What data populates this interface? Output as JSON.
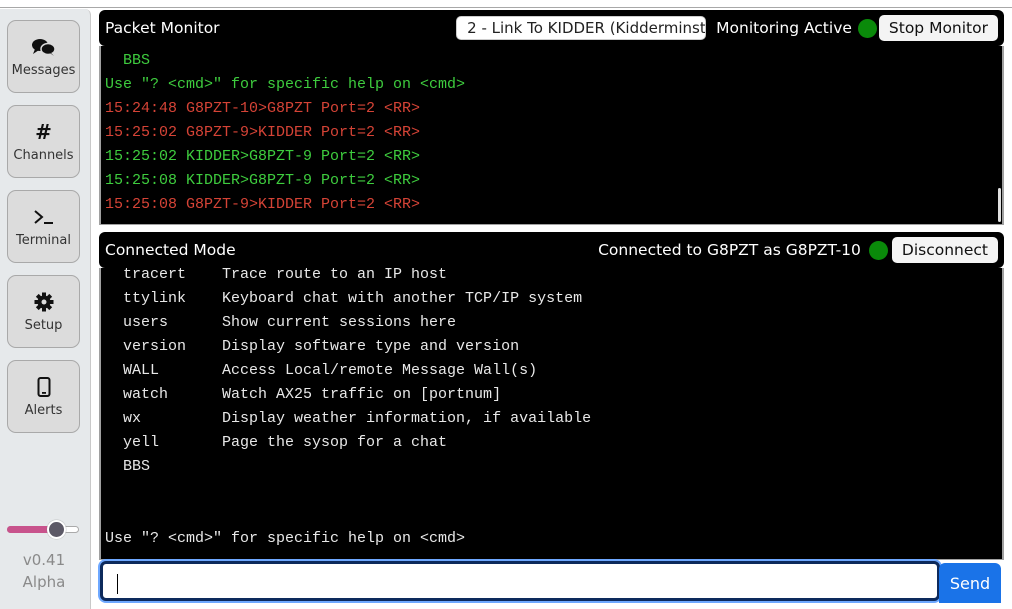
{
  "sidebar": {
    "items": [
      {
        "label": "Messages",
        "icon": "chat-bubbles-icon"
      },
      {
        "label": "Channels",
        "icon": "hash-icon"
      },
      {
        "label": "Terminal",
        "icon": "terminal-icon"
      },
      {
        "label": "Setup",
        "icon": "gear-icon"
      },
      {
        "label": "Alerts",
        "icon": "phone-icon"
      }
    ],
    "slider_value": 0.65,
    "version": "v0.41",
    "release": "Alpha"
  },
  "monitor": {
    "title": "Packet Monitor",
    "port_select": "2 - Link To KIDDER (Kidderminst",
    "status": "Monitoring Active",
    "status_color": "#0a8a0a",
    "stop_label": "Stop Monitor",
    "lines": [
      {
        "text": "  BBS",
        "color": "green"
      },
      {
        "text": "Use \"? <cmd>\" for specific help on <cmd>",
        "color": "green"
      },
      {
        "text": "15:24:48 G8PZT-10>G8PZT Port=2 <RR>",
        "color": "red"
      },
      {
        "text": "15:25:02 G8PZT-9>KIDDER Port=2 <RR>",
        "color": "red"
      },
      {
        "text": "15:25:02 KIDDER>G8PZT-9 Port=2 <RR>",
        "color": "green"
      },
      {
        "text": "15:25:08 KIDDER>G8PZT-9 Port=2 <RR>",
        "color": "green"
      },
      {
        "text": "15:25:08 G8PZT-9>KIDDER Port=2 <RR>",
        "color": "red"
      }
    ]
  },
  "connected": {
    "title": "Connected Mode",
    "status": "Connected to G8PZT as G8PZT-10",
    "status_color": "#0a8a0a",
    "disconnect_label": "Disconnect",
    "lines": [
      "  tracert    Trace route to an IP host",
      "  ttylink    Keyboard chat with another TCP/IP system",
      "  users      Show current sessions here",
      "  version    Display software type and version",
      "  WALL       Access Local/remote Message Wall(s)",
      "  watch      Watch AX25 traffic on [portnum]",
      "  wx         Display weather information, if available",
      "  yell       Page the sysop for a chat",
      "  BBS",
      "",
      "",
      "Use \"? <cmd>\" for specific help on <cmd>"
    ]
  },
  "input": {
    "value": "",
    "placeholder": "",
    "send_label": "Send"
  }
}
